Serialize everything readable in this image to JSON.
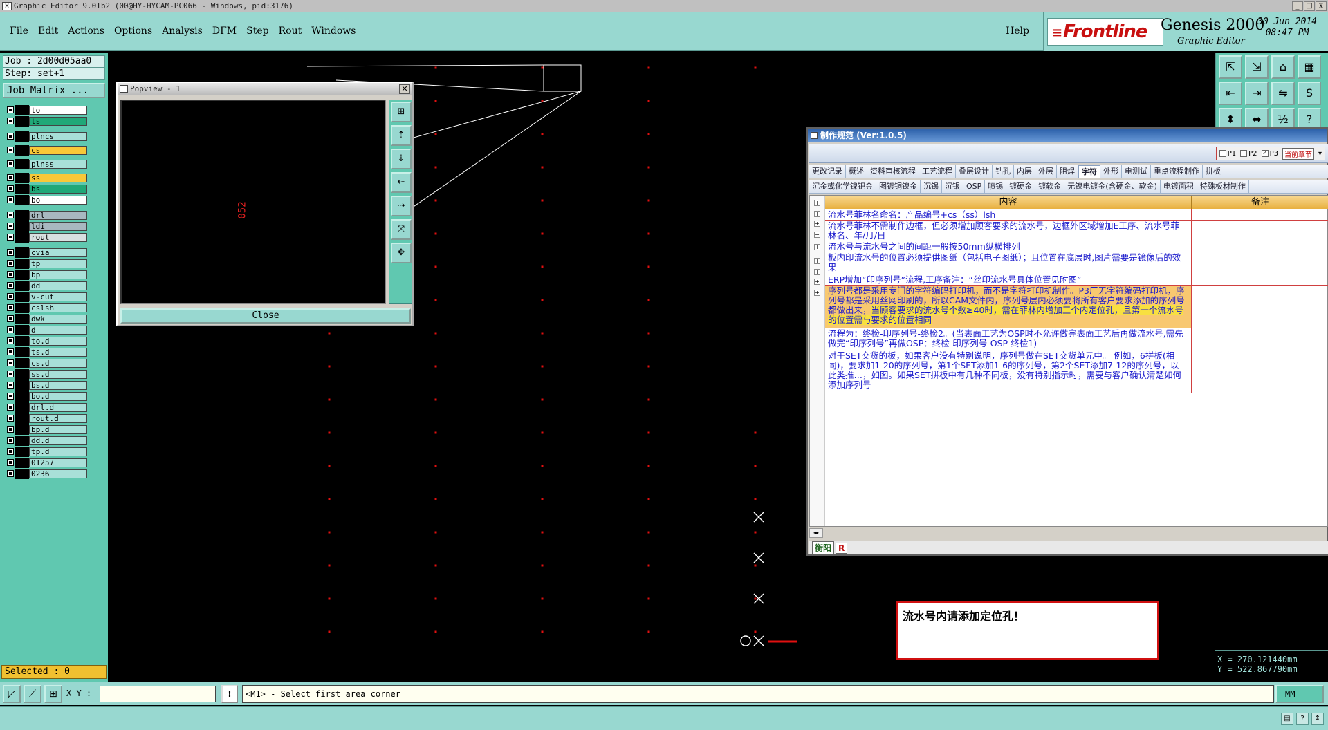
{
  "window": {
    "title": "Graphic Editor 9.0Tb2 (00@HY-HYCAM-PC066 - Windows, pid:3176)",
    "buttons": [
      "_",
      "□",
      "x"
    ]
  },
  "menu": {
    "items": [
      "File",
      "Edit",
      "Actions",
      "Options",
      "Analysis",
      "DFM",
      "Step",
      "Rout",
      "Windows"
    ],
    "help": "Help"
  },
  "brand": {
    "logo": "Frontline",
    "product": "Genesis 2000",
    "subtitle": "Graphic Editor",
    "date": "30 Jun 2014",
    "time": "08:47 PM"
  },
  "job": {
    "job_label": "Job : 2d00d05aa0",
    "step_label": "Step: set+1",
    "matrix_button": "Job Matrix ..."
  },
  "layers": [
    {
      "name": "to",
      "color": "#ffffff"
    },
    {
      "name": "ts",
      "color": "#20a878"
    },
    {
      "name": "plncs",
      "color": "#a8e0d8"
    },
    {
      "name": "cs",
      "color": "#f8c838"
    },
    {
      "name": "plnss",
      "color": "#a8e0d8"
    },
    {
      "name": "ss",
      "color": "#f8c838"
    },
    {
      "name": "bs",
      "color": "#20a878"
    },
    {
      "name": "bo",
      "color": "#ffffff"
    },
    {
      "name": "drl",
      "color": "#a8b8c0"
    },
    {
      "name": "ldi",
      "color": "#a8b8c0"
    },
    {
      "name": "rout",
      "color": "#d8e0e0"
    },
    {
      "name": "cvia",
      "color": "#a8e0d8"
    },
    {
      "name": "tp",
      "color": "#a8e0d8"
    },
    {
      "name": "bp",
      "color": "#a8e0d8"
    },
    {
      "name": "dd",
      "color": "#a8e0d8"
    },
    {
      "name": "v-cut",
      "color": "#a8e0d8"
    },
    {
      "name": "cslsh",
      "color": "#a8e0d8"
    },
    {
      "name": "dwk",
      "color": "#a8e0d8"
    },
    {
      "name": "d",
      "color": "#a8e0d8"
    },
    {
      "name": "to.d",
      "color": "#a8e0d8"
    },
    {
      "name": "ts.d",
      "color": "#a8e0d8"
    },
    {
      "name": "cs.d",
      "color": "#a8e0d8"
    },
    {
      "name": "ss.d",
      "color": "#a8e0d8"
    },
    {
      "name": "bs.d",
      "color": "#a8e0d8"
    },
    {
      "name": "bo.d",
      "color": "#a8e0d8"
    },
    {
      "name": "drl.d",
      "color": "#a8e0d8"
    },
    {
      "name": "rout.d",
      "color": "#a8e0d8"
    },
    {
      "name": "bp.d",
      "color": "#a8e0d8"
    },
    {
      "name": "dd.d",
      "color": "#a8e0d8"
    },
    {
      "name": "tp.d",
      "color": "#a8e0d8"
    },
    {
      "name": "01257",
      "color": "#a8e0d8"
    },
    {
      "name": "0236",
      "color": "#a8e0d8"
    }
  ],
  "selected_text": "Selected : 0",
  "popview": {
    "title": "Popview - 1",
    "label": "052",
    "close": "Close",
    "tool_icons": [
      "zoom-icon",
      "up-icon",
      "down-icon",
      "left-icon",
      "right-icon",
      "fit-icon",
      "center-icon"
    ]
  },
  "spec": {
    "title": "制作规范 (Ver:1.0.5)",
    "pages": {
      "p1": "P1",
      "p2": "P2",
      "p3": "P3",
      "current": "当前章节"
    },
    "tabs_row1": [
      "更改记录",
      "概述",
      "资料审核流程",
      "工艺流程",
      "叠层设计",
      "钻孔",
      "内层",
      "外层",
      "阻焊",
      "字符",
      "外形",
      "电测试",
      "重点流程制作",
      "拼板"
    ],
    "active_tab": "字符",
    "tabs_row2": [
      "沉金或化学镍钯金",
      "图镀铜镍金",
      "沉锡",
      "沉银",
      "OSP",
      "喷锡",
      "镀硬金",
      "镀软金",
      "无镍电镀金(含硬金、软金)",
      "电镀面积",
      "特殊板材制作"
    ],
    "header": {
      "content": "内容",
      "remark": "备注"
    },
    "rows": [
      {
        "text": "流水号菲林名命名：产品编号+cs（ss）lsh"
      },
      {
        "text": "流水号菲林不需制作边框，但必须增加顾客要求的流水号，边框外区域增加E工序、流水号菲林名、年/月/日"
      },
      {
        "text": "流水号与流水号之间的间距一般按50mm纵横排列"
      },
      {
        "text": "板内印流水号的位置必须提供图纸（包括电子图纸）；且位置在底层时,图片需要是镜像后的效果"
      },
      {
        "text": "ERP增加“印序列号”流程,工序备注：“丝印流水号具体位置见附图”"
      },
      {
        "text_a": "序列号都是采用专门的字符编码打印机，而不是字符打印机制作。P3厂无字符编码打印机，序列号都是采用丝网印刷的，所以CAM文件内，序列号层内必须要将所有客户要求添加的序列号都做出来，",
        "text_b": "当顾客要求的流水号个数≥40时，需在菲林内增加三个内定位孔，且第一个流水号的位置需与要求的位置相同"
      },
      {
        "text": "流程为：终检-印序列号-终检2。(当表面工艺为OSP时不允许做完表面工艺后再做流水号,需先做完“印序列号”再做OSP：终检-印序列号-OSP-终检1)"
      },
      {
        "text": "对于SET交货的板，如果客户没有特别说明，序列号做在SET交货单元中。 例如，6拼板(相同)，要求加1-20的序列号，第1个SET添加1-6的序列号，第2个SET添加7-12的序列号，以此类推…，如图。如果SET拼板中有几种不同板，没有特别指示时，需要与客户确认清楚如何添加序列号"
      }
    ],
    "footer": {
      "tag1": "衡阳",
      "tag2": "R"
    }
  },
  "notice": "流水号内请添加定位孔！",
  "coords": {
    "x": "X = 270.121440mm",
    "y": "Y = 522.867790mm"
  },
  "status": {
    "xy_label": "X Y :",
    "xy_value": "",
    "prompt": "<M1> - Select first area corner",
    "units": "MM"
  },
  "colors": {
    "panel": "#98d8d0",
    "accent": "#60c8b0",
    "pad_red": "#e01010",
    "highlight": "#f8c870"
  }
}
